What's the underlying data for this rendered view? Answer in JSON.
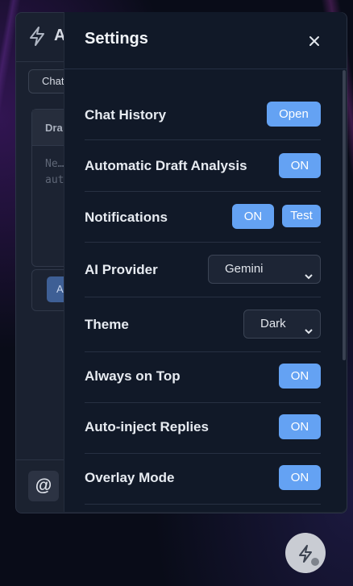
{
  "background": {
    "accent": "#5a2a8a"
  },
  "app": {
    "title": "A",
    "tab_label": "Chat",
    "draft_title": "Dra",
    "draft_placeholder": "Ne…\naut",
    "action_label": "A",
    "at_label": "@"
  },
  "settings": {
    "title": "Settings",
    "close_icon": "close-icon",
    "rows": {
      "chat_history": {
        "label": "Chat History",
        "button": "Open"
      },
      "draft_analysis": {
        "label": "Automatic Draft Analysis",
        "toggle": "ON"
      },
      "notifications": {
        "label": "Notifications",
        "toggle": "ON",
        "test": "Test"
      },
      "ai_provider": {
        "label": "AI Provider",
        "value": "Gemini"
      },
      "theme": {
        "label": "Theme",
        "value": "Dark"
      },
      "always_on_top": {
        "label": "Always on Top",
        "toggle": "ON"
      },
      "auto_inject": {
        "label": "Auto-inject Replies",
        "toggle": "ON"
      },
      "overlay": {
        "label": "Overlay Mode",
        "toggle": "ON"
      }
    }
  },
  "colors": {
    "accent": "#64a2f3",
    "panel": "#111928",
    "window": "#1a2130"
  },
  "fab": {
    "icon": "bolt-icon"
  }
}
